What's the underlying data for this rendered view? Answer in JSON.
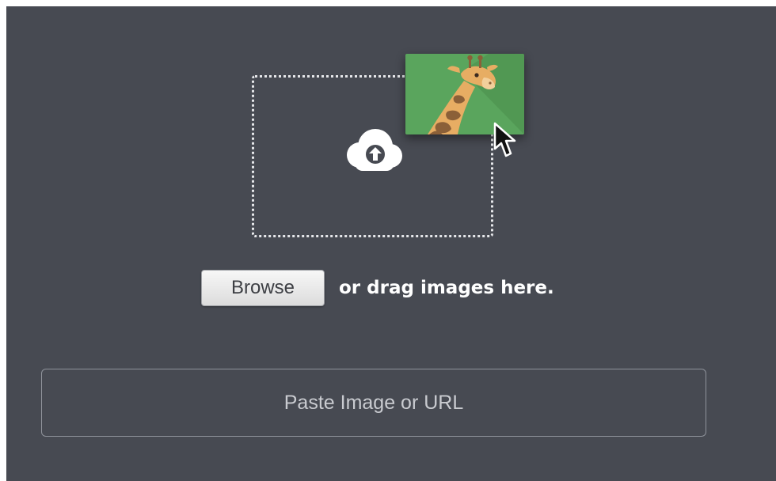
{
  "upload": {
    "browse_label": "Browse",
    "drag_text": "or drag images here.",
    "paste_placeholder": "Paste Image or URL"
  },
  "icons": {
    "upload": "cloud-upload-icon",
    "preview": "giraffe-image-thumbnail",
    "pointer": "mouse-cursor-icon"
  },
  "colors": {
    "background": "#474a52",
    "drop_border": "#e6e7ea",
    "thumbnail_green": "#5aa55d",
    "giraffe": "#e7ad63",
    "text": "#ffffff"
  }
}
